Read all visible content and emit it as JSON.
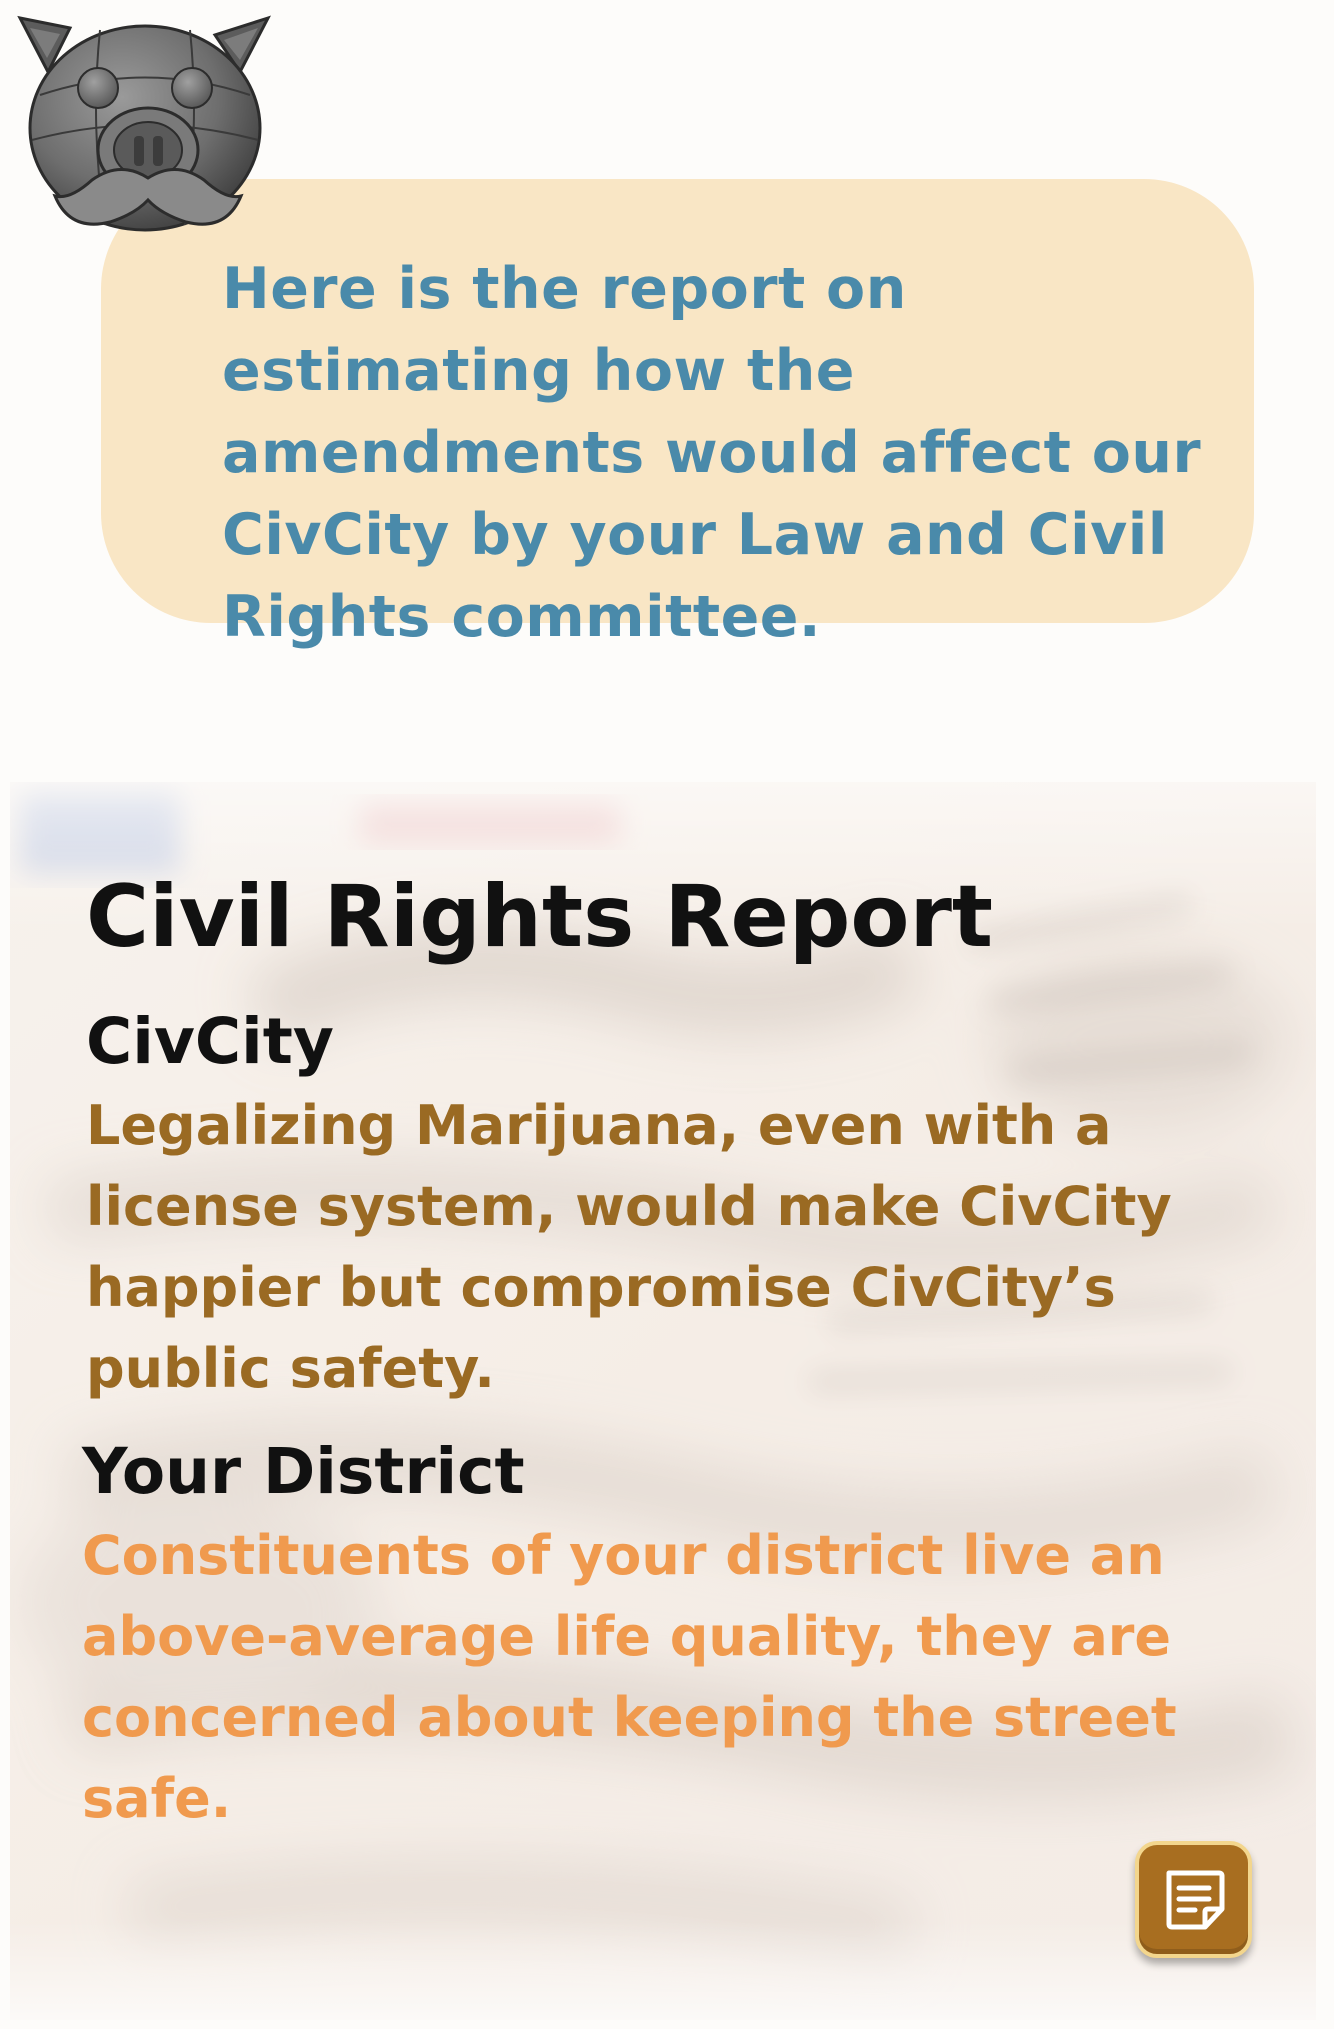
{
  "mascot": {
    "icon": "robot-pig-mascot-icon"
  },
  "speech_bubble": {
    "message": "Here is the report on estimating how the amendments would affect our CivCity by your Law and Civil Rights committee."
  },
  "report": {
    "title": "Civil Rights Report",
    "sections": [
      {
        "label": "CivCity",
        "body": "Legalizing Marijuana, even with a license system, would make CivCity happier but compromise CivCity’s public safety."
      },
      {
        "label": "Your District",
        "body": "Constituents of your district live an above-average life quality, they are concerned about keeping the street safe."
      }
    ]
  },
  "notes_button": {
    "icon": "note-icon"
  },
  "colors": {
    "bubble_background": "#f9e6c5",
    "bubble_text": "#4a8aaa",
    "civcity_text": "#9a6a23",
    "district_text": "#f09a4e",
    "button_background": "#a86e20"
  }
}
